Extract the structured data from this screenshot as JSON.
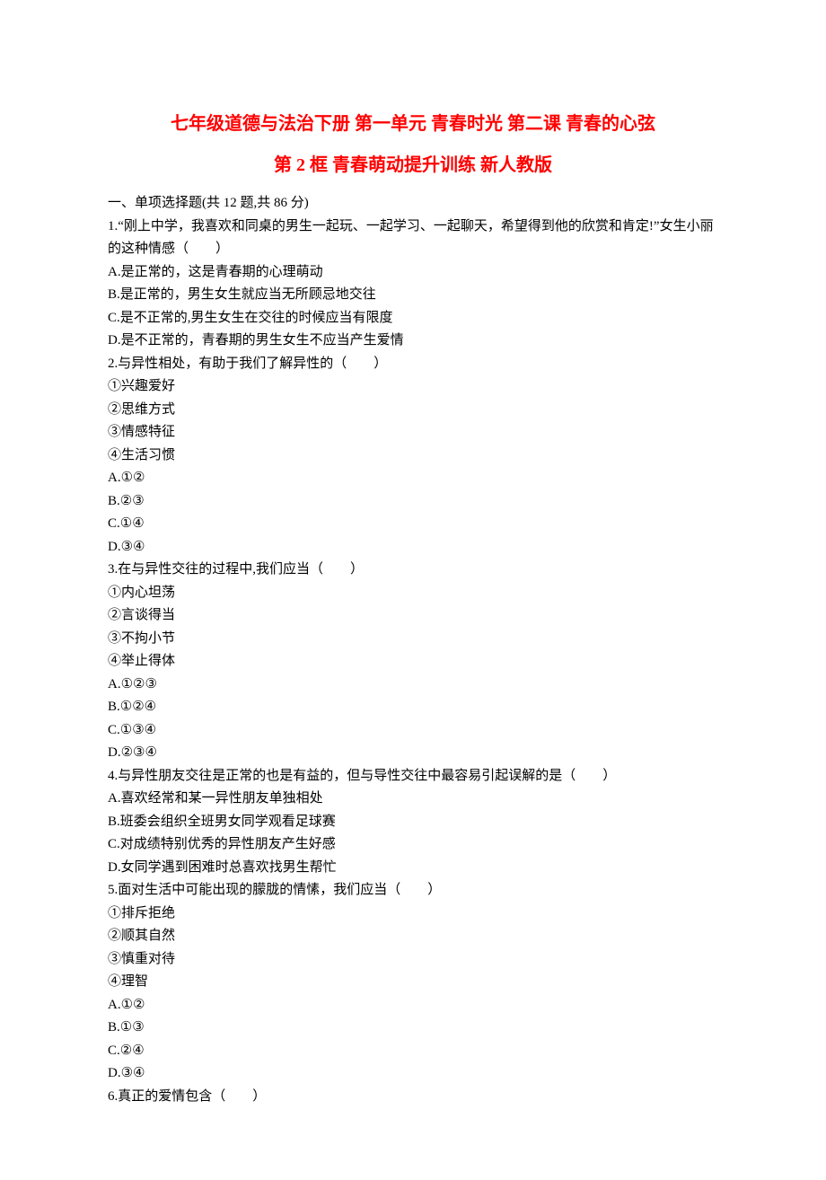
{
  "title_line1": "七年级道德与法治下册 第一单元 青春时光 第二课 青春的心弦",
  "title_line2": "第 2 框 青春萌动提升训练 新人教版",
  "section_header": "一、单项选择题(共 12 题,共 86 分)",
  "questions": [
    {
      "stem": "1.“刚上中学，我喜欢和同桌的男生一起玩、一起学习、一起聊天，希望得到他的欣赏和肯定!”女生小丽的这种情感（　　）",
      "options": [
        "A.是正常的，这是青春期的心理萌动",
        "B.是正常的，男生女生就应当无所顾忌地交往",
        "C.是不正常的,男生女生在交往的时候应当有限度",
        "D.是不正常的，青春期的男生女生不应当产生爱情"
      ]
    },
    {
      "stem": "2.与异性相处，有助于我们了解异性的（　　）",
      "subitems": [
        "①兴趣爱好",
        "②思维方式",
        "③情感特征",
        "④生活习惯"
      ],
      "options": [
        "A.①②",
        "B.②③",
        "C.①④",
        "D.③④"
      ]
    },
    {
      "stem": "3.在与异性交往的过程中,我们应当（　　）",
      "subitems": [
        "①内心坦荡",
        "②言谈得当",
        "③不拘小节",
        "④举止得体"
      ],
      "options": [
        "A.①②③",
        "B.①②④",
        "C.①③④",
        "D.②③④"
      ]
    },
    {
      "stem": "4.与异性朋友交往是正常的也是有益的，但与导性交往中最容易引起误解的是（　　）",
      "options": [
        "A.喜欢经常和某一异性朋友单独相处",
        "B.班委会组织全班男女同学观看足球赛",
        "C.对成绩特别优秀的异性朋友产生好感",
        "D.女同学遇到困难时总喜欢找男生帮忙"
      ]
    },
    {
      "stem": "5.面对生活中可能出现的朦胧的情愫，我们应当（　　）",
      "subitems": [
        "①排斥拒绝",
        "②顺其自然",
        "③慎重对待",
        "④理智"
      ],
      "options": [
        "A.①②",
        "B.①③",
        "C.②④",
        "D.③④"
      ]
    },
    {
      "stem": "6.真正的爱情包含（　　）"
    }
  ]
}
